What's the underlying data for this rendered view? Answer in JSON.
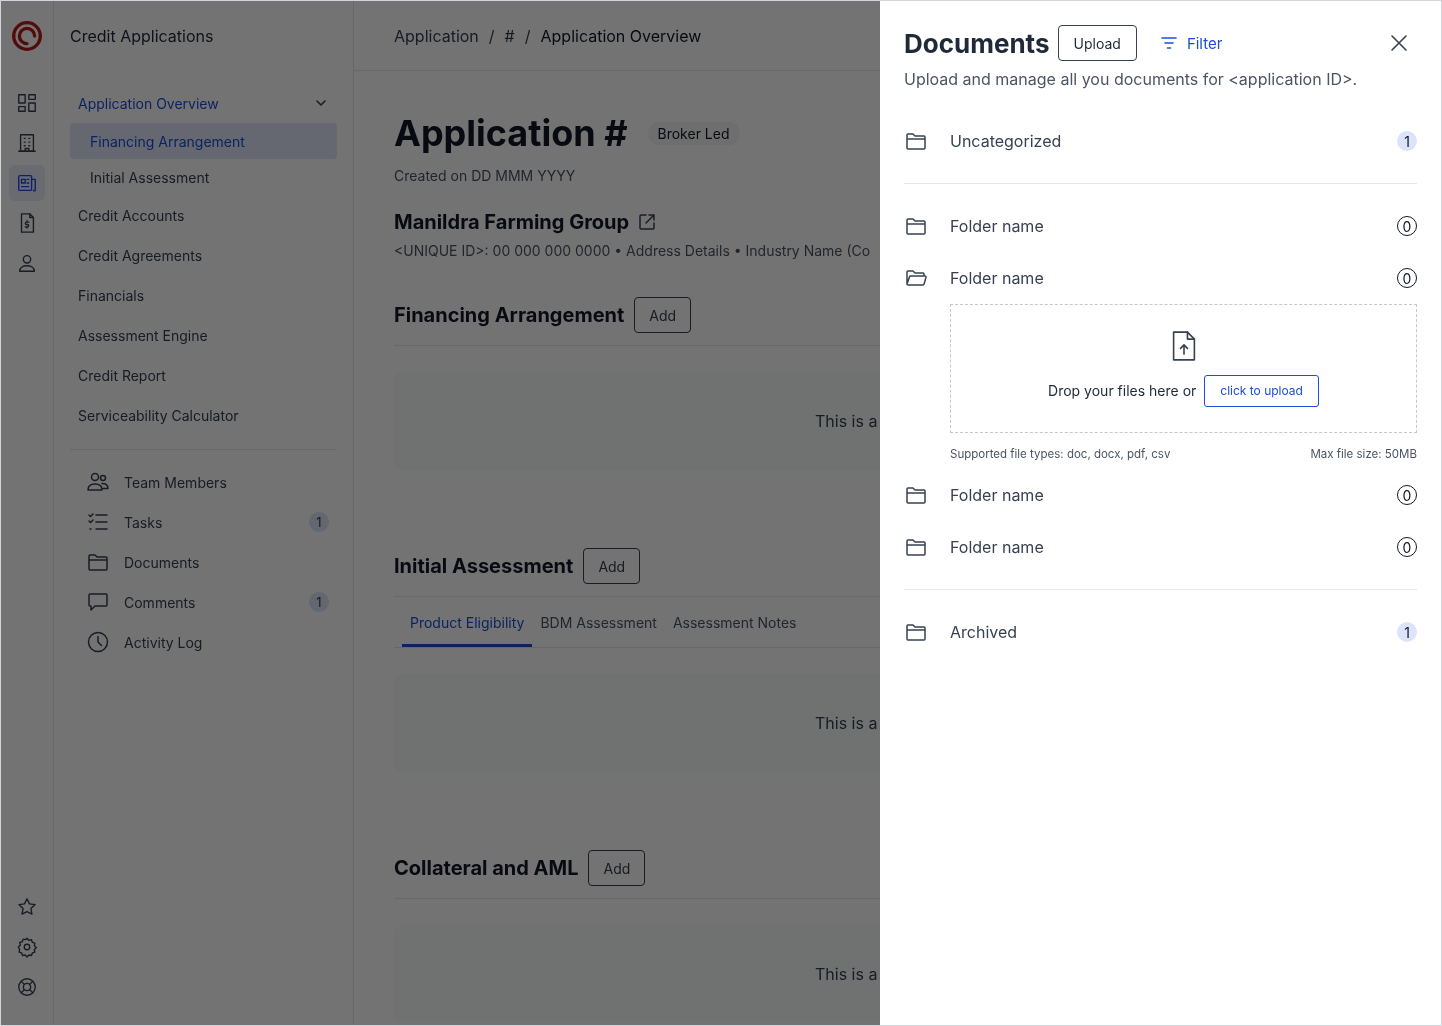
{
  "app": {
    "title": "Credit Applications"
  },
  "rail": {
    "items": [
      {
        "kind": "grid",
        "selected": false
      },
      {
        "kind": "building",
        "selected": false
      },
      {
        "kind": "newspaper",
        "selected": true
      },
      {
        "kind": "receipt",
        "selected": false
      },
      {
        "kind": "user",
        "selected": false
      }
    ],
    "bottom": [
      {
        "kind": "star"
      },
      {
        "kind": "gear"
      },
      {
        "kind": "lifebuoy"
      }
    ]
  },
  "nav": {
    "items": [
      {
        "label": "Application Overview",
        "selected": false,
        "expanded": true,
        "children": [
          {
            "label": "Financing Arrangement",
            "selected": true
          },
          {
            "label": "Initial Assessment",
            "selected": false
          }
        ]
      },
      {
        "label": "Credit Accounts",
        "selected": false
      },
      {
        "label": "Credit Agreements",
        "selected": false
      },
      {
        "label": "Financials",
        "selected": false
      },
      {
        "label": "Assessment Engine",
        "selected": false
      },
      {
        "label": "Credit Report",
        "selected": false
      },
      {
        "label": "Serviceability Calculator",
        "selected": false
      }
    ],
    "links": [
      {
        "kind": "team",
        "label": "Team Members"
      },
      {
        "kind": "tasks",
        "label": "Tasks",
        "badge": "1"
      },
      {
        "kind": "folder",
        "label": "Documents"
      },
      {
        "kind": "comment",
        "label": "Comments",
        "badge": "1"
      },
      {
        "kind": "clock",
        "label": "Activity Log"
      }
    ]
  },
  "breadcrumb": {
    "separator": "/",
    "items": [
      "Application",
      "#",
      "Application Overview"
    ]
  },
  "header": {
    "title": "Application #",
    "tag": "Broker Led",
    "created": "Created on DD MMM YYYY",
    "company": "Manildra Farming Group",
    "meta": "<UNIQUE ID>: 00 000 000 0000 • Address Details • Industry Name (Co"
  },
  "sections": [
    {
      "title": "Financing Arrangement",
      "button": "Add",
      "placeholder": "This is a"
    },
    {
      "title": "Initial Assessment",
      "button": "Add",
      "tabs": [
        {
          "label": "Product Eligibility",
          "selected": true
        },
        {
          "label": "BDM Assessment",
          "selected": false
        },
        {
          "label": "Assessment Notes",
          "selected": false
        }
      ],
      "placeholder": "This is a"
    },
    {
      "title": "Collateral and AML",
      "button": "Add",
      "placeholder": "This is a"
    }
  ],
  "drawer": {
    "title": "Documents",
    "upload": "Upload",
    "filter": "Filter",
    "description": "Upload and manage all you documents for <application ID>.",
    "groups": [
      [
        {
          "name": "Uncategorized",
          "count": "1",
          "highlighted": true,
          "expanded": false
        }
      ],
      [
        {
          "name": "Folder name",
          "count": "0",
          "highlighted": false,
          "expanded": false
        },
        {
          "name": "Folder name",
          "count": "0",
          "highlighted": false,
          "expanded": true
        },
        {
          "name": "Folder name",
          "count": "0",
          "highlighted": false,
          "expanded": false
        },
        {
          "name": "Folder name",
          "count": "0",
          "highlighted": false,
          "expanded": false
        }
      ],
      [
        {
          "name": "Archived",
          "count": "1",
          "highlighted": true,
          "expanded": false
        }
      ]
    ],
    "dropzone": {
      "text": "Drop your files here or",
      "button": "click to upload",
      "types": "Supported file types: doc, docx, pdf, csv",
      "max": "Max file size: 50MB"
    }
  }
}
